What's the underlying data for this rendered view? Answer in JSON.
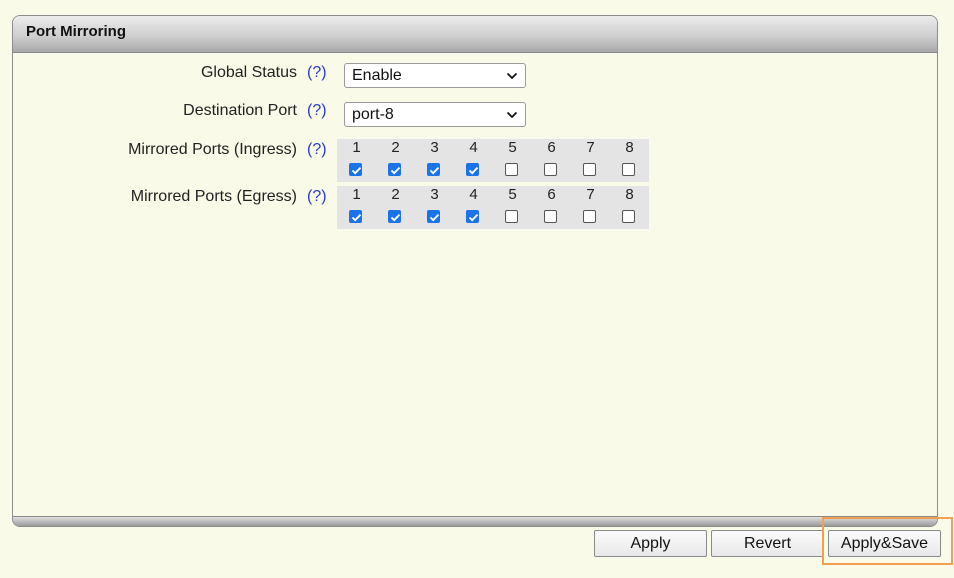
{
  "panel": {
    "title": "Port Mirroring"
  },
  "form": {
    "global_status": {
      "label": "Global Status",
      "help": "(?)",
      "value": "Enable"
    },
    "destination_port": {
      "label": "Destination Port",
      "help": "(?)",
      "value": "port-8"
    },
    "ingress": {
      "label": "Mirrored Ports (Ingress)",
      "help": "(?)",
      "ports": [
        {
          "num": "1",
          "checked": true
        },
        {
          "num": "2",
          "checked": true
        },
        {
          "num": "3",
          "checked": true
        },
        {
          "num": "4",
          "checked": true
        },
        {
          "num": "5",
          "checked": false
        },
        {
          "num": "6",
          "checked": false
        },
        {
          "num": "7",
          "checked": false
        },
        {
          "num": "8",
          "checked": false
        }
      ]
    },
    "egress": {
      "label": "Mirrored Ports (Egress)",
      "help": "(?)",
      "ports": [
        {
          "num": "1",
          "checked": true
        },
        {
          "num": "2",
          "checked": true
        },
        {
          "num": "3",
          "checked": true
        },
        {
          "num": "4",
          "checked": true
        },
        {
          "num": "5",
          "checked": false
        },
        {
          "num": "6",
          "checked": false
        },
        {
          "num": "7",
          "checked": false
        },
        {
          "num": "8",
          "checked": false
        }
      ]
    }
  },
  "buttons": {
    "apply": "Apply",
    "revert": "Revert",
    "apply_save": "Apply&Save"
  },
  "colors": {
    "checkbox_checked": "#1a73e8",
    "help_link": "#2a3ad0",
    "highlight": "#f0a050",
    "background": "#fafae8"
  }
}
